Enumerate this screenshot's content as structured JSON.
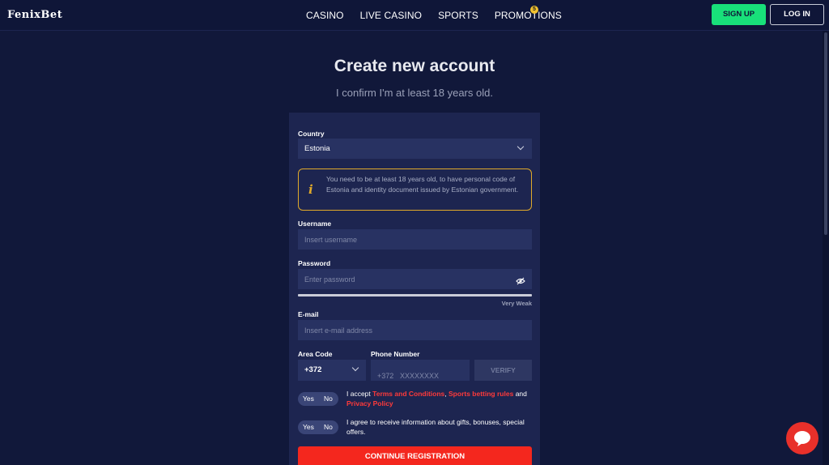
{
  "header": {
    "logo": "FenixBet",
    "nav": [
      "CASINO",
      "LIVE CASINO",
      "SPORTS",
      "PROMOTIONS"
    ],
    "promo_badge": "5",
    "signup_label": "SIGN UP",
    "login_label": "LOG IN"
  },
  "page": {
    "title": "Create new account",
    "subtitle": "I confirm I'm at least 18 years old."
  },
  "form": {
    "country_label": "Country",
    "country_value": "Estonia",
    "info_text": "You need to be at least 18 years old, to have personal code of Estonia and identity document issued by Estonian government.",
    "username_label": "Username",
    "username_placeholder": "Insert username",
    "password_label": "Password",
    "password_placeholder": "Enter password",
    "password_strength": "Very Weak",
    "email_label": "E-mail",
    "email_placeholder": "Insert e-mail address",
    "area_code_label": "Area Code",
    "area_code_value": "+372",
    "phone_label": "Phone Number",
    "phone_prefix": "+372",
    "phone_placeholder": "XXXXXXXX",
    "verify_label": "VERIFY",
    "toggle_yes": "Yes",
    "toggle_no": "No",
    "terms_prefix": "I accept",
    "terms_link": "Terms and Conditions",
    "terms_sep": ",",
    "sports_rules_link": "Sports betting rules",
    "terms_and": "and",
    "privacy_link": "Privacy Policy",
    "marketing_text": "I agree to receive information about gifts, bonuses, special offers.",
    "continue_label": "CONTINUE REGISTRATION"
  },
  "colors": {
    "background": "#11183a",
    "panel": "#1d2550",
    "signup": "#18e07a",
    "accent_red": "#f4271e",
    "info_border": "#e0a92a"
  },
  "icons": [
    "chevron-down-icon",
    "info-icon",
    "eye-slash-icon",
    "chat-icon"
  ]
}
